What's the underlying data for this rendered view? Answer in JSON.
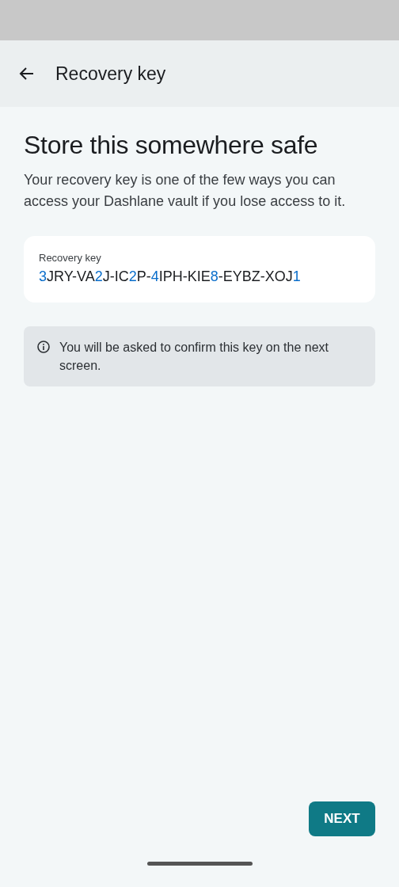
{
  "app_bar": {
    "title": "Recovery key"
  },
  "heading": "Store this somewhere safe",
  "description": "Your recovery key is one of the few ways you can access your Dashlane vault if you lose access to it.",
  "key_card": {
    "label": "Recovery key",
    "segments": [
      {
        "kind": "digit",
        "text": "3"
      },
      {
        "kind": "letter",
        "text": "JRY-VA"
      },
      {
        "kind": "digit",
        "text": "2"
      },
      {
        "kind": "letter",
        "text": "J-IC"
      },
      {
        "kind": "digit",
        "text": "2"
      },
      {
        "kind": "letter",
        "text": "P-"
      },
      {
        "kind": "digit",
        "text": "4"
      },
      {
        "kind": "letter",
        "text": "IPH-KIE"
      },
      {
        "kind": "digit",
        "text": "8"
      },
      {
        "kind": "letter",
        "text": "-EYBZ-XOJ"
      },
      {
        "kind": "digit",
        "text": "1"
      }
    ]
  },
  "info": {
    "text": "You will be asked to confirm this key on the next screen."
  },
  "next_button": {
    "label": "NEXT"
  }
}
